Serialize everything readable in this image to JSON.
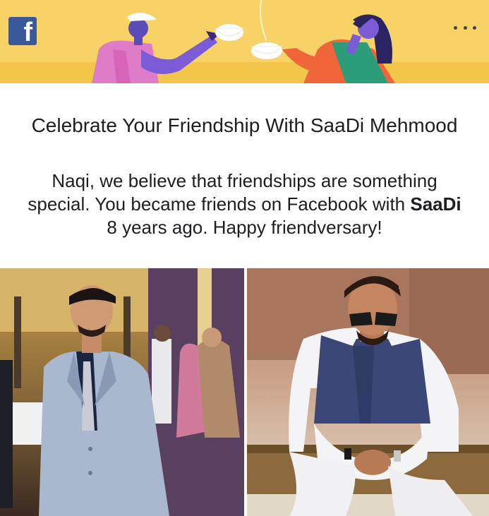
{
  "header": {
    "logo_letter": "f",
    "more_menu": "more-options",
    "background_color": "#f7d266",
    "brand_color": "#3b5998"
  },
  "card": {
    "title": "Celebrate Your Friendship With SaaDi Mehmood",
    "body_prefix": "Naqi, we believe that friendships are something special. You became friends on Facebook with ",
    "friend_name": "SaaDi",
    "body_suffix": " 8 years ago. Happy friendversary!"
  },
  "photos": [
    {
      "id": "user-photo",
      "description": "man in grey suit at event"
    },
    {
      "id": "friend-photo",
      "description": "man in navy vest and sunglasses"
    }
  ]
}
